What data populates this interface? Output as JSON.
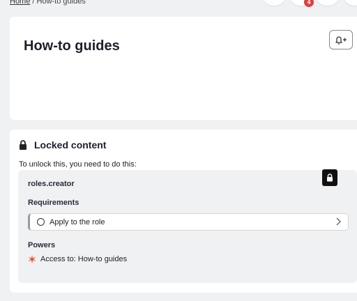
{
  "breadcrumb": {
    "home": "Home",
    "separator": " / ",
    "current": "How-to guides"
  },
  "topbar": {
    "notification_count": "4",
    "badge_color": "#e03c3c"
  },
  "page": {
    "title": "How-to guides",
    "subscribe_icon": "bell-plus-icon"
  },
  "locked": {
    "icon": "lock-icon",
    "title": "Locked content",
    "unlock_text": "To unlock this, you need to do this:",
    "role": "roles.creator",
    "requirements_label": "Requirements",
    "requirements": [
      {
        "label": "Apply to the role",
        "status_icon": "empty-circle-icon"
      }
    ],
    "powers_label": "Powers",
    "powers": [
      {
        "label": "Access to: How-to guides",
        "icon": "sparkle-icon"
      }
    ],
    "accent_color": "#e8553e"
  }
}
